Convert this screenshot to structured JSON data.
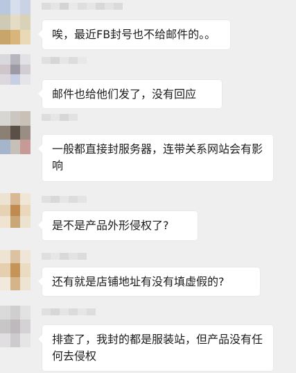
{
  "messages": [
    {
      "text": "唉，最近FB封号也不给邮件的。。"
    },
    {
      "text": "邮件也给他们发了，没有回应"
    },
    {
      "text": "一般都直接封服务器，连带关系网站会有影响"
    },
    {
      "text": "是不是产品外形侵权了?"
    },
    {
      "text": "还有就是店铺地址有没有填虚假的?"
    },
    {
      "text": "排查了，我封的都是服装站，但产品没有任何去侵权"
    }
  ]
}
